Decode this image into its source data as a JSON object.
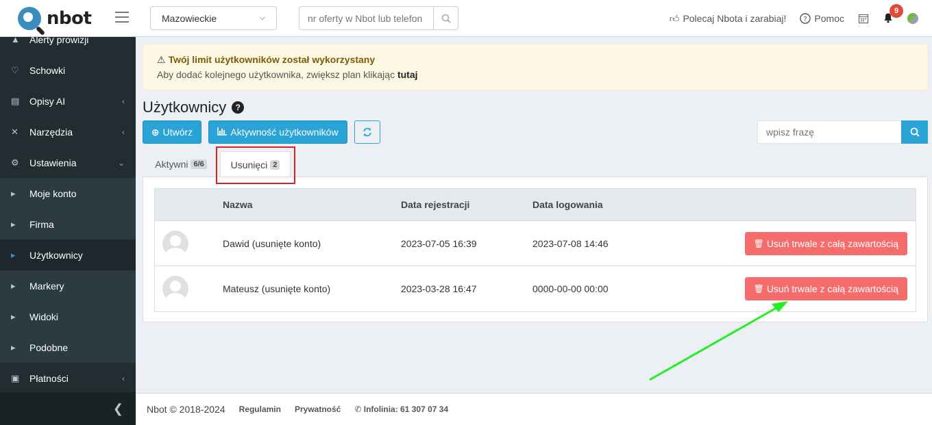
{
  "header": {
    "logo_text": "nbot",
    "region": "Mazowieckie",
    "search_placeholder": "nr oferty w Nbot lub telefon",
    "recommend_label": "Polecaj Nbota i zarabiaj!",
    "help_label": "Pomoc",
    "notifications_count": "9"
  },
  "sidebar": {
    "items": [
      {
        "label": "Alerty prowizji",
        "icon": "warning-icon"
      },
      {
        "label": "Schowki",
        "icon": "heart-icon"
      },
      {
        "label": "Opisy AI",
        "icon": "comment-icon"
      },
      {
        "label": "Narzędzia",
        "icon": "wrench-icon"
      },
      {
        "label": "Ustawienia",
        "icon": "gear-icon"
      },
      {
        "label": "Moje konto",
        "icon": "caret-right-icon"
      },
      {
        "label": "Firma",
        "icon": "caret-right-icon"
      },
      {
        "label": "Użytkownicy",
        "icon": "caret-right-icon"
      },
      {
        "label": "Markery",
        "icon": "caret-right-icon"
      },
      {
        "label": "Widoki",
        "icon": "caret-right-icon"
      },
      {
        "label": "Podobne",
        "icon": "caret-right-icon"
      },
      {
        "label": "Płatności",
        "icon": "cart-icon"
      }
    ]
  },
  "alert": {
    "title": "Twój limit użytkowników został wykorzystany",
    "text": "Aby dodać kolejnego użytkownika, zwiększ plan klikając",
    "link": "tutaj"
  },
  "page": {
    "title": "Użytkownicy",
    "create_label": "Utwórz",
    "activity_label": "Aktywność użytkowników",
    "search_placeholder": "wpisz frazę"
  },
  "tabs": [
    {
      "label": "Aktywni",
      "count": "6/6"
    },
    {
      "label": "Usunięci",
      "count": "2"
    }
  ],
  "table": {
    "headers": [
      "Nazwa",
      "Data rejestracji",
      "Data logowania"
    ],
    "rows": [
      {
        "name": "Dawid (usunięte konto)",
        "registered": "2023-07-05 16:39",
        "last_login": "2023-07-08 14:46",
        "action": "Usuń trwale z całą zawartością"
      },
      {
        "name": "Mateusz (usunięte konto)",
        "registered": "2023-03-28 16:47",
        "last_login": "0000-00-00 00:00",
        "action": "Usuń trwale z całą zawartością"
      }
    ]
  },
  "footer": {
    "copyright": "Nbot © 2018-2024",
    "terms": "Regulamin",
    "privacy": "Prywatność",
    "hotline": "Infolinia: 61 307 07 34"
  },
  "colors": {
    "accent": "#2aa3d6",
    "danger": "#f56c6c",
    "sidebar": "#222d32",
    "annotation_box": "#e02020",
    "annotation_arrow": "#22ee22"
  }
}
